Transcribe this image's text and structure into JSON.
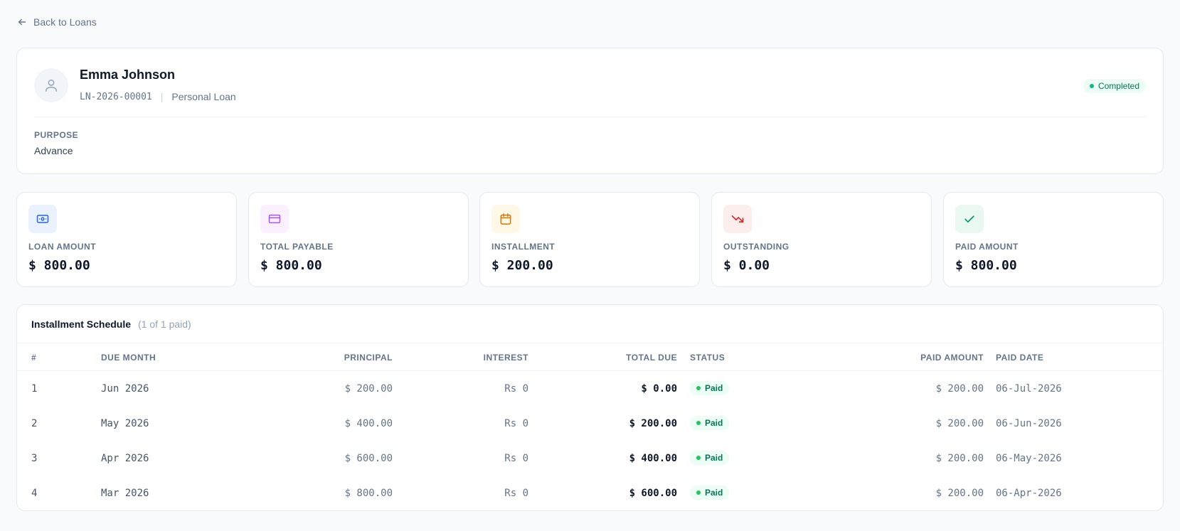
{
  "nav": {
    "back_label": "Back to Loans"
  },
  "borrower": {
    "name": "Emma Johnson",
    "loan_code": "LN-2026-00001",
    "loan_type": "Personal Loan",
    "status": "Completed",
    "purpose_label": "PURPOSE",
    "purpose_value": "Advance"
  },
  "stats": [
    {
      "label": "LOAN AMOUNT",
      "value": "$ 800.00",
      "icon": "cash-icon",
      "bg": "#eaf2ff",
      "color": "#2563eb"
    },
    {
      "label": "TOTAL PAYABLE",
      "value": "$ 800.00",
      "icon": "credit-card-icon",
      "bg": "#faf0ff",
      "color": "#a855f7"
    },
    {
      "label": "INSTALLMENT",
      "value": "$ 200.00",
      "icon": "calendar-icon",
      "bg": "#fff8e6",
      "color": "#d97706"
    },
    {
      "label": "OUTSTANDING",
      "value": "$ 0.00",
      "icon": "trending-down-icon",
      "bg": "#fdeeee",
      "color": "#dc2626"
    },
    {
      "label": "PAID AMOUNT",
      "value": "$ 800.00",
      "icon": "check-icon",
      "bg": "#e9f9f1",
      "color": "#059669"
    }
  ],
  "schedule": {
    "title": "Installment Schedule",
    "subtitle": "(1 of 1 paid)",
    "columns": [
      "#",
      "DUE MONTH",
      "PRINCIPAL",
      "INTEREST",
      "TOTAL DUE",
      "STATUS",
      "PAID AMOUNT",
      "PAID DATE"
    ],
    "rows": [
      {
        "num": "1",
        "due_month": "Jun 2026",
        "principal": "$ 200.00",
        "interest": "Rs 0",
        "total_due": "$ 0.00",
        "status": "Paid",
        "paid_amount": "$ 200.00",
        "paid_date": "06-Jul-2026"
      },
      {
        "num": "2",
        "due_month": "May 2026",
        "principal": "$ 400.00",
        "interest": "Rs 0",
        "total_due": "$ 200.00",
        "status": "Paid",
        "paid_amount": "$ 200.00",
        "paid_date": "06-Jun-2026"
      },
      {
        "num": "3",
        "due_month": "Apr 2026",
        "principal": "$ 600.00",
        "interest": "Rs 0",
        "total_due": "$ 400.00",
        "status": "Paid",
        "paid_amount": "$ 200.00",
        "paid_date": "06-May-2026"
      },
      {
        "num": "4",
        "due_month": "Mar 2026",
        "principal": "$ 800.00",
        "interest": "Rs 0",
        "total_due": "$ 600.00",
        "status": "Paid",
        "paid_amount": "$ 200.00",
        "paid_date": "06-Apr-2026"
      }
    ]
  }
}
